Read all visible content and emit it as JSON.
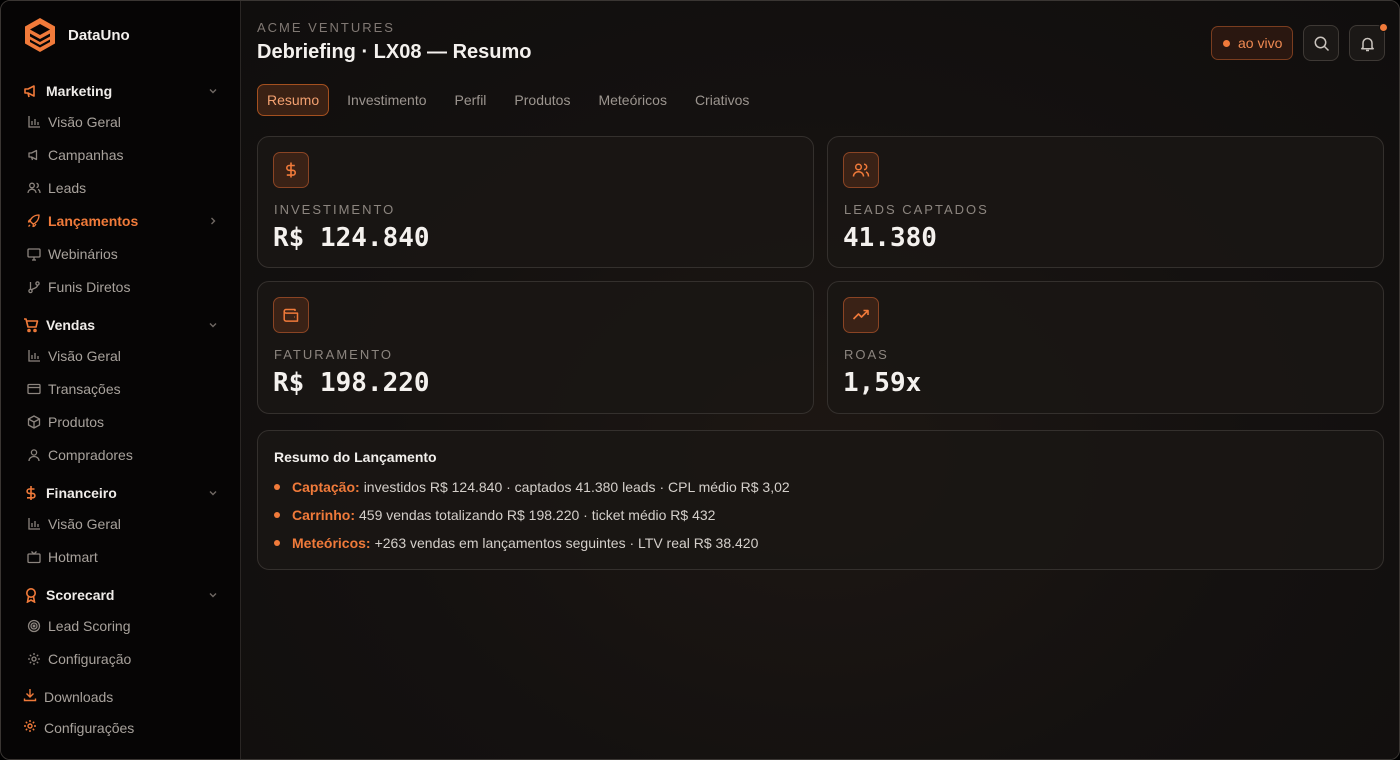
{
  "brand": {
    "name": "DataUno",
    "accent": "#f07a3a"
  },
  "sidebar": {
    "groups": [
      {
        "label": "Marketing",
        "icon": "megaphone-icon",
        "items": [
          {
            "label": "Visão Geral",
            "icon": "bar-chart-icon"
          },
          {
            "label": "Campanhas",
            "icon": "megaphone-icon"
          },
          {
            "label": "Leads",
            "icon": "users-icon"
          },
          {
            "label": "Lançamentos",
            "icon": "rocket-icon",
            "active": true
          },
          {
            "label": "Webinários",
            "icon": "monitor-icon"
          },
          {
            "label": "Funis Diretos",
            "icon": "git-branch-icon"
          }
        ]
      },
      {
        "label": "Vendas",
        "icon": "cart-icon",
        "items": [
          {
            "label": "Visão Geral",
            "icon": "bar-chart-icon"
          },
          {
            "label": "Transações",
            "icon": "credit-card-icon"
          },
          {
            "label": "Produtos",
            "icon": "package-icon"
          },
          {
            "label": "Compradores",
            "icon": "user-icon"
          }
        ]
      },
      {
        "label": "Financeiro",
        "icon": "dollar-icon",
        "items": [
          {
            "label": "Visão Geral",
            "icon": "bar-chart-icon"
          },
          {
            "label": "Hotmart",
            "icon": "tv-icon"
          }
        ]
      },
      {
        "label": "Scorecard",
        "icon": "award-icon",
        "items": [
          {
            "label": "Lead Scoring",
            "icon": "target-icon"
          },
          {
            "label": "Configuração",
            "icon": "gear-icon"
          }
        ]
      }
    ],
    "bottom": [
      {
        "label": "Downloads",
        "icon": "download-icon"
      },
      {
        "label": "Configurações",
        "icon": "gear-icon"
      }
    ]
  },
  "header": {
    "org": "ACME VENTURES",
    "title": "Debriefing · LX08 — Resumo",
    "live_label": "ao vivo"
  },
  "tabs": [
    "Resumo",
    "Investimento",
    "Perfil",
    "Produtos",
    "Meteóricos",
    "Criativos"
  ],
  "active_tab": "Resumo",
  "kpis": [
    {
      "label": "INVESTIMENTO",
      "value": "R$ 124.840",
      "icon": "dollar-icon"
    },
    {
      "label": "LEADS CAPTADOS",
      "value": "41.380",
      "icon": "users-icon"
    },
    {
      "label": "FATURAMENTO",
      "value": "R$ 198.220",
      "icon": "wallet-icon"
    },
    {
      "label": "ROAS",
      "value": "1,59x",
      "icon": "trending-up-icon"
    }
  ],
  "summary": {
    "title": "Resumo do Lançamento",
    "rows": [
      {
        "key": "Captação:",
        "text": "investidos R$ 124.840 · captados 41.380 leads · CPL médio R$ 3,02"
      },
      {
        "key": "Carrinho:",
        "text": "459 vendas totalizando R$ 198.220 · ticket médio R$ 432"
      },
      {
        "key": "Meteóricos:",
        "text": "+263 vendas em lançamentos seguintes · LTV real R$ 38.420"
      }
    ]
  }
}
